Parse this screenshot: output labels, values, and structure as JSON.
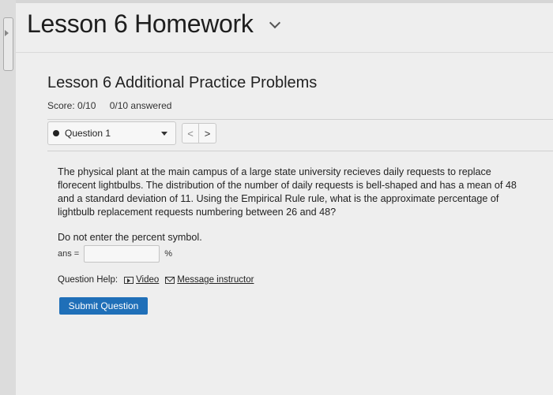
{
  "header": {
    "title": "Lesson 6 Homework",
    "crumb_partial": "Lesson 6 Homework"
  },
  "assignment": {
    "section_title": "Lesson 6 Additional Practice Problems",
    "score": "Score: 0/10",
    "answered": "0/10 answered"
  },
  "question_nav": {
    "selected": "Question 1",
    "prev_symbol": "<",
    "next_symbol": ">"
  },
  "question": {
    "text": "The physical plant at the main campus of a large state university recieves daily requests to replace florecent lightbulbs. The distribution of the number of daily requests is bell-shaped and has a mean of 48 and a standard deviation of 11. Using the Empirical Rule rule, what is the approximate percentage of lightbulb replacement requests numbering between 26 and 48?",
    "instruction": "Do not enter the percent symbol.",
    "answer_label": "ans =",
    "answer_value": "",
    "answer_unit": "%"
  },
  "help": {
    "label": "Question Help:",
    "video": "Video",
    "message": "Message instructor"
  },
  "submit_label": "Submit Question",
  "colors": {
    "accent": "#1f6fb8",
    "background": "#eeeeee"
  },
  "icons": {
    "title_dropdown": "chevron-down-icon",
    "question_status": "filled-dot-icon",
    "video": "video-play-icon",
    "message": "envelope-icon"
  }
}
